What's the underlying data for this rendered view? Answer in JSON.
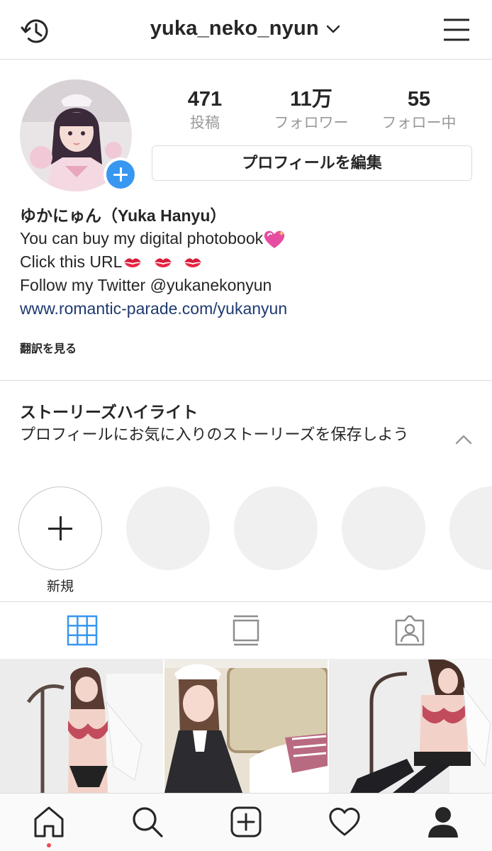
{
  "header": {
    "username": "yuka_neko_nyun",
    "icons": {
      "history": "history-clock-icon",
      "dropdown": "chevron-down-icon",
      "menu": "hamburger-menu-icon"
    }
  },
  "profile": {
    "stats": [
      {
        "value": "471",
        "label": "投稿"
      },
      {
        "value": "11万",
        "label": "フォロワー"
      },
      {
        "value": "55",
        "label": "フォロー中"
      }
    ],
    "edit_button": "プロフィールを編集",
    "add_story_icon": "plus-circle-icon"
  },
  "bio": {
    "name": "ゆかにゅん（Yuka Hanyu）",
    "line1": "You can buy my digital photobook",
    "line1_emoji": "sparkling-heart-emoji",
    "line2": "Click this URL",
    "line2_emoji": "kiss-mark-emoji",
    "line3": "Follow my Twitter @yukanekonyun",
    "link": "www.romantic-parade.com/yukanyun",
    "translate": "翻訳を見る"
  },
  "highlights": {
    "title": "ストーリーズハイライト",
    "subtitle": "プロフィールにお気に入りのストーリーズを保存しよう",
    "new_label": "新規",
    "toggle_icon": "chevron-up-icon"
  },
  "tabs": [
    {
      "icon": "grid-icon",
      "active": true
    },
    {
      "icon": "feed-list-icon",
      "active": false
    },
    {
      "icon": "tagged-person-icon",
      "active": false
    }
  ],
  "bottom_nav": [
    {
      "icon": "home-icon",
      "notification_dot": true
    },
    {
      "icon": "search-icon"
    },
    {
      "icon": "new-post-icon"
    },
    {
      "icon": "heart-icon"
    },
    {
      "icon": "profile-icon",
      "active": true
    }
  ],
  "colors": {
    "accent_blue": "#3897f0",
    "link_blue": "#1e3a70",
    "secondary_text": "#999999",
    "border": "#dbdbdb",
    "notification_red": "#ed4956"
  }
}
